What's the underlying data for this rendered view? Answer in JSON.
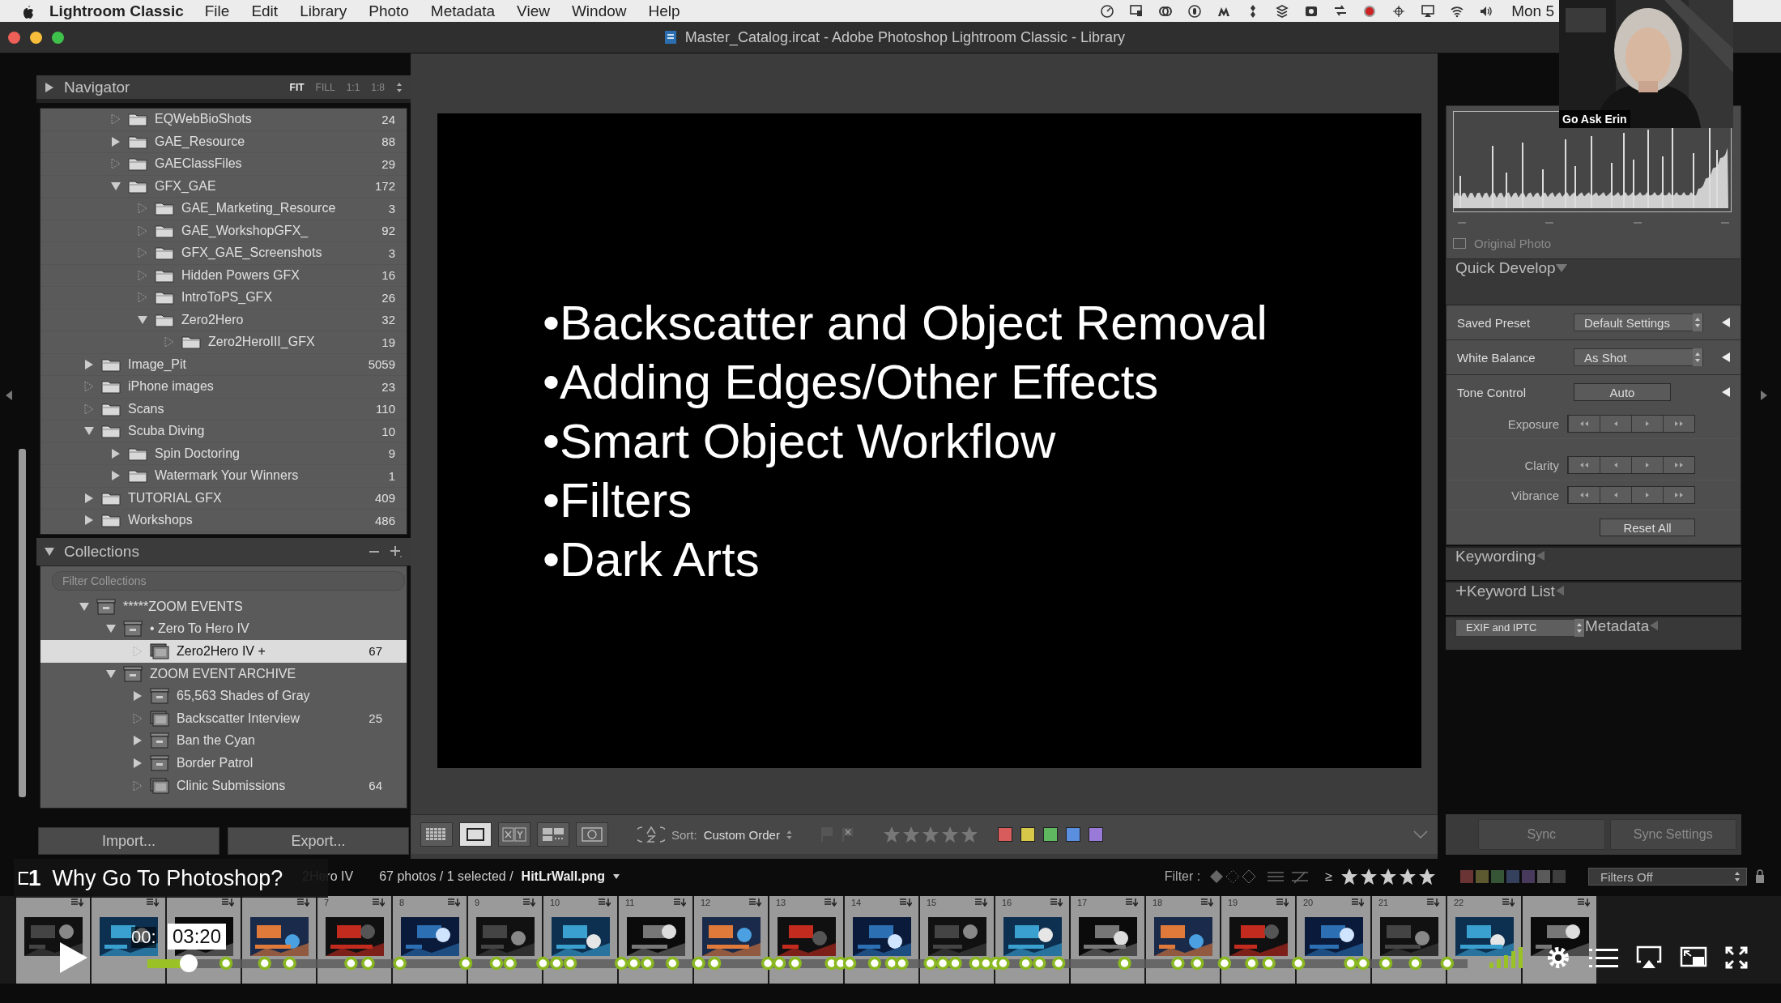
{
  "menu_bar": {
    "app": "Lightroom Classic",
    "items": [
      "File",
      "Edit",
      "Library",
      "Photo",
      "Metadata",
      "View",
      "Window",
      "Help"
    ],
    "clock": "Mon 5"
  },
  "window": {
    "title": "Master_Catalog.ircat - Adobe Photoshop Lightroom Classic - Library"
  },
  "navigator": {
    "title": "Navigator",
    "zoom_options": [
      {
        "label": "FIT",
        "selected": true
      },
      {
        "label": "FILL",
        "selected": false
      },
      {
        "label": "1:1",
        "selected": false
      },
      {
        "label": "1:8",
        "selected": false
      }
    ]
  },
  "folders": {
    "continued": [
      {
        "name": "EQWebBioShots",
        "count": "24",
        "expanded": false,
        "has_subfolders": false
      },
      {
        "name": "GAE_Resource",
        "count": "88",
        "expanded": false,
        "has_subfolders": true
      },
      {
        "name": "GAEClassFiles",
        "count": "29",
        "expanded": false,
        "has_subfolders": false
      },
      {
        "name": "GFX_GAE",
        "count": "172",
        "expanded": true,
        "has_subfolders": true,
        "children": [
          {
            "name": "GAE_Marketing_Resource",
            "count": "3",
            "expanded": false,
            "has_subfolders": false
          },
          {
            "name": "GAE_WorkshopGFX_",
            "count": "92",
            "expanded": false,
            "has_subfolders": false
          },
          {
            "name": "GFX_GAE_Screenshots",
            "count": "3",
            "expanded": false,
            "has_subfolders": false
          },
          {
            "name": "Hidden Powers GFX",
            "count": "16",
            "expanded": false,
            "has_subfolders": false
          },
          {
            "name": "IntroToPS_GFX",
            "count": "26",
            "expanded": false,
            "has_subfolders": false
          },
          {
            "name": "Zero2Hero",
            "count": "32",
            "expanded": true,
            "has_subfolders": true,
            "children": [
              {
                "name": "Zero2HeroIII_GFX",
                "count": "19",
                "expanded": false,
                "has_subfolders": false
              }
            ]
          }
        ]
      }
    ],
    "items": [
      {
        "name": "Image_Pit",
        "count": "5059",
        "expanded": false,
        "has_subfolders": true
      },
      {
        "name": "iPhone images",
        "count": "23",
        "expanded": false,
        "has_subfolders": false
      },
      {
        "name": "Scans",
        "count": "110",
        "expanded": false,
        "has_subfolders": false
      },
      {
        "name": "Scuba Diving",
        "count": "10",
        "expanded": true,
        "has_subfolders": true,
        "children": [
          {
            "name": "Spin Doctoring",
            "count": "9",
            "expanded": false,
            "has_subfolders": true
          },
          {
            "name": "Watermark Your Winners",
            "count": "1",
            "expanded": false,
            "has_subfolders": true
          }
        ]
      },
      {
        "name": "TUTORIAL GFX",
        "count": "409",
        "expanded": false,
        "has_subfolders": true
      },
      {
        "name": "Workshops",
        "count": "486",
        "expanded": false,
        "has_subfolders": true
      }
    ]
  },
  "collections": {
    "title": "Collections",
    "search": {
      "placeholder": "Filter Collections"
    },
    "items": [
      {
        "kind": "set",
        "name": "*****ZOOM EVENTS",
        "expanded": true,
        "selected": false,
        "children": [
          {
            "kind": "set",
            "name": "• Zero To Hero IV",
            "expanded": true,
            "selected": false,
            "children": [
              {
                "kind": "collection",
                "name": "Zero2Hero IV +",
                "count": "67",
                "selected": true
              }
            ]
          },
          {
            "kind": "set",
            "name": "ZOOM EVENT ARCHIVE",
            "expanded": true,
            "selected": false,
            "children": [
              {
                "kind": "set",
                "name": "65,563 Shades of Gray",
                "expanded": false,
                "selected": false
              },
              {
                "kind": "collection",
                "name": "Backscatter Interview",
                "count": "25",
                "selected": false
              },
              {
                "kind": "set",
                "name": "Ban the Cyan",
                "expanded": false,
                "selected": false
              },
              {
                "kind": "set",
                "name": "Border Patrol",
                "expanded": false,
                "selected": false
              },
              {
                "kind": "collection",
                "name": "Clinic Submissions",
                "count": "64",
                "selected": false
              }
            ]
          }
        ]
      }
    ]
  },
  "left_buttons": [
    "Import...",
    "Export..."
  ],
  "slide": {
    "bullets": [
      "•Backscatter and Object Removal",
      "•Adding Edges/Other Effects",
      "•Smart Object Workflow",
      "•Filters",
      "•Dark Arts"
    ]
  },
  "toolbar": {
    "view_modes": [
      {
        "kind": "grid",
        "selected": false
      },
      {
        "kind": "loupe",
        "selected": true
      },
      {
        "kind": "compare",
        "selected": false
      },
      {
        "kind": "survey",
        "selected": false
      },
      {
        "kind": "people",
        "selected": false
      }
    ],
    "sort_label": "Sort:",
    "sort_value": "Custom Order",
    "stars": 0,
    "color_labels": [
      {
        "color": "#d85c5c"
      },
      {
        "color": "#d8c84a"
      },
      {
        "color": "#5fb85f"
      },
      {
        "color": "#5a8fe0"
      },
      {
        "color": "#9a7ad8"
      }
    ]
  },
  "histogram": {
    "original_photo": {
      "label": "Original Photo",
      "checked": false
    }
  },
  "quick_develop": {
    "title": "Quick Develop",
    "saved_preset": {
      "label": "Saved Preset",
      "value": "Default Settings"
    },
    "white_balance": {
      "label": "White Balance",
      "value": "As Shot"
    },
    "tone_control": {
      "label": "Tone Control",
      "button": "Auto"
    },
    "adjustments": [
      "Exposure",
      "Clarity",
      "Vibrance"
    ],
    "reset": "Reset All"
  },
  "right_panels": [
    {
      "kind": "plain",
      "title": "Keywording"
    },
    {
      "kind": "add",
      "title": "Keyword List"
    },
    {
      "kind": "preset",
      "title": "Metadata",
      "preset": "EXIF and IPTC"
    }
  ],
  "sync_buttons": [
    {
      "label": "Sync",
      "disabled": true
    },
    {
      "label": "Sync Settings",
      "disabled": true
    }
  ],
  "filter_bar": {
    "source": "2Hero IV",
    "info": "67 photos / 1 selected /",
    "file": "HitLrWall.png",
    "filter_label": "Filter :",
    "rating_op": "≥",
    "filter_preset": "Filters Off",
    "color_swatches": [
      {
        "color": "#6a3434"
      },
      {
        "color": "#5c5830"
      },
      {
        "color": "#365436"
      },
      {
        "color": "#34405c"
      },
      {
        "color": "#483a5c"
      },
      {
        "color": "#5a5a5a"
      },
      {
        "color": "#3e3e3e"
      }
    ]
  },
  "filmstrip": [
    {
      "kind": "picture"
    },
    {
      "kind": "picture"
    },
    {
      "kind": "picture"
    },
    {
      "kind": "picture"
    },
    {
      "kind": "picture",
      "number": "7"
    },
    {
      "kind": "picture",
      "number": "8"
    },
    {
      "kind": "picture",
      "number": "9"
    },
    {
      "kind": "picture",
      "number": "10"
    },
    {
      "kind": "picture",
      "number": "11"
    },
    {
      "kind": "picture",
      "number": "12"
    },
    {
      "kind": "picture",
      "number": "13"
    },
    {
      "kind": "picture",
      "number": "14"
    },
    {
      "kind": "picture",
      "number": "15"
    },
    {
      "kind": "picture",
      "number": "16"
    },
    {
      "kind": "picture",
      "number": "17"
    },
    {
      "kind": "picture",
      "number": "18"
    },
    {
      "kind": "picture",
      "number": "19"
    },
    {
      "kind": "picture",
      "number": "20"
    },
    {
      "kind": "picture",
      "number": "21"
    },
    {
      "kind": "picture",
      "number": "22"
    },
    {
      "kind": "picture"
    }
  ],
  "video": {
    "chapter_number": "1",
    "chapter_title": "Why Go To Photoshop?",
    "current_time": "00:",
    "hover_time": "03:20",
    "level": 0.03
  },
  "webcam": {
    "kind": "picture",
    "label": "Go Ask Erin"
  }
}
